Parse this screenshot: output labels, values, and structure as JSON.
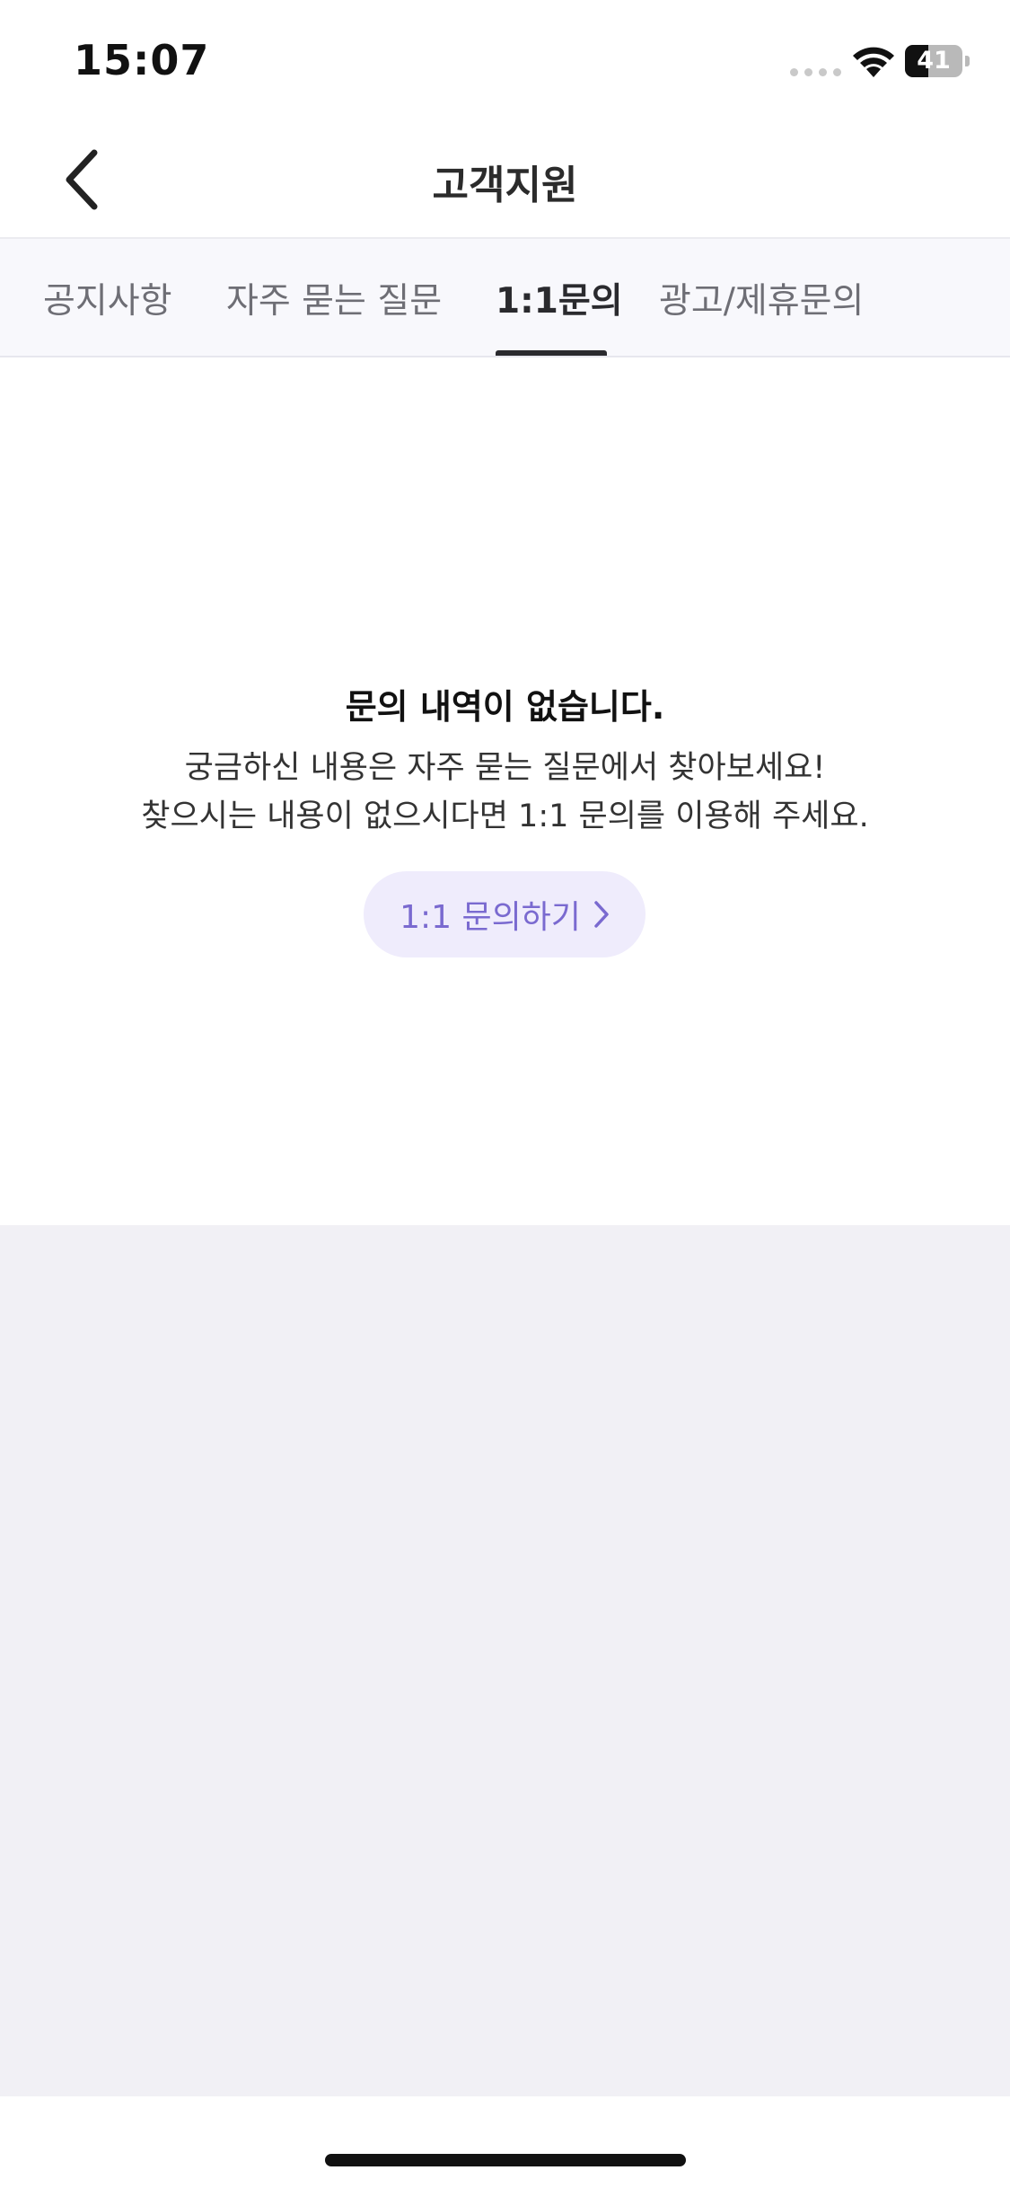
{
  "status_bar": {
    "time": "15:07",
    "battery_level": "41",
    "battery_fraction": 0.41
  },
  "header": {
    "title": "고객지원",
    "back_icon": "chevron-left-icon"
  },
  "tabs": [
    {
      "label": "공지사항",
      "active": false
    },
    {
      "label": "자주 묻는 질문",
      "active": false
    },
    {
      "label": "1:1문의",
      "active": true
    },
    {
      "label": "광고/제휴문의",
      "active": false
    }
  ],
  "empty_state": {
    "title": "문의 내역이 없습니다.",
    "description_line1": "궁금하신 내용은 자주 묻는 질문에서 찾아보세요!",
    "description_line2": "찾으시는 내용이 없으시다면 1:1 문의를 이용해 주세요.",
    "button_label": "1:1 문의하기",
    "button_icon": "chevron-right-icon"
  },
  "colors": {
    "accent": "#7a6ad0",
    "accent_bg": "#efecfc",
    "tab_bg": "#f8f8fc",
    "gray_area": "#f1f0f5"
  }
}
